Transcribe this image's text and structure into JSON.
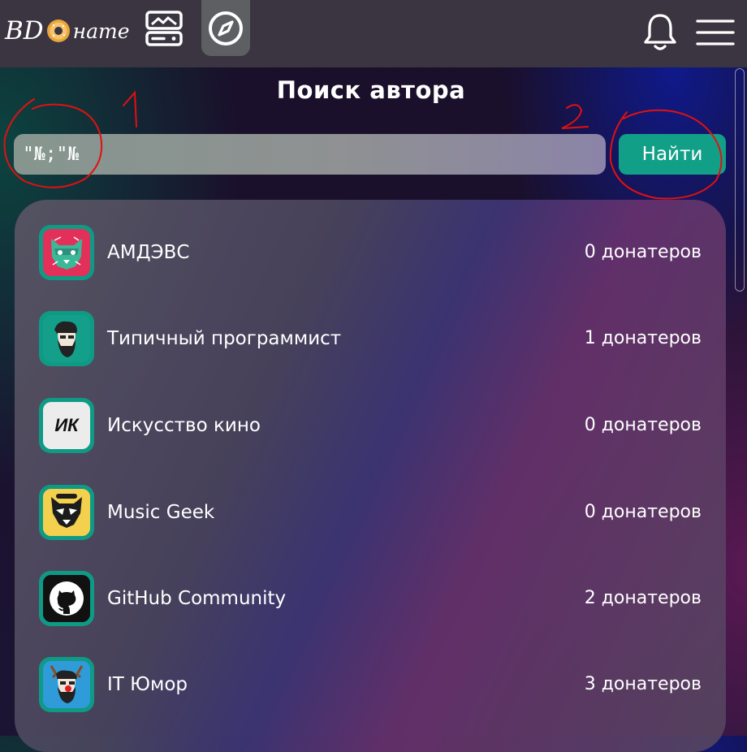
{
  "header": {
    "logo_part1": "BD",
    "logo_part2": "нате",
    "icons": [
      "feed-icon",
      "compass-icon",
      "bell-icon",
      "menu-icon"
    ]
  },
  "page": {
    "title": "Поиск автора"
  },
  "search": {
    "value": "\"№;\"№",
    "button_label": "Найти"
  },
  "annotations": {
    "label_1": "1",
    "label_2": "2",
    "color": "#e31010"
  },
  "authors": [
    {
      "name": "АМДЭВС",
      "donors": "0 донатеров",
      "avatar": "cat-icon"
    },
    {
      "name": "Типичный программист",
      "donors": "1 донатеров",
      "avatar": "bearded-man-icon"
    },
    {
      "name": "Искусство кино",
      "donors": "0 донатеров",
      "avatar": "ik-logo",
      "avatar_text": "ИК"
    },
    {
      "name": "Music Geek",
      "donors": "0 донатеров",
      "avatar": "raccoon-icon"
    },
    {
      "name": "GitHub Community",
      "donors": "2 донатеров",
      "avatar": "github-icon"
    },
    {
      "name": "IT Юмор",
      "donors": "3 донатеров",
      "avatar": "deer-man-icon"
    }
  ],
  "colors": {
    "accent": "#11a087",
    "header": "#3a3540"
  }
}
